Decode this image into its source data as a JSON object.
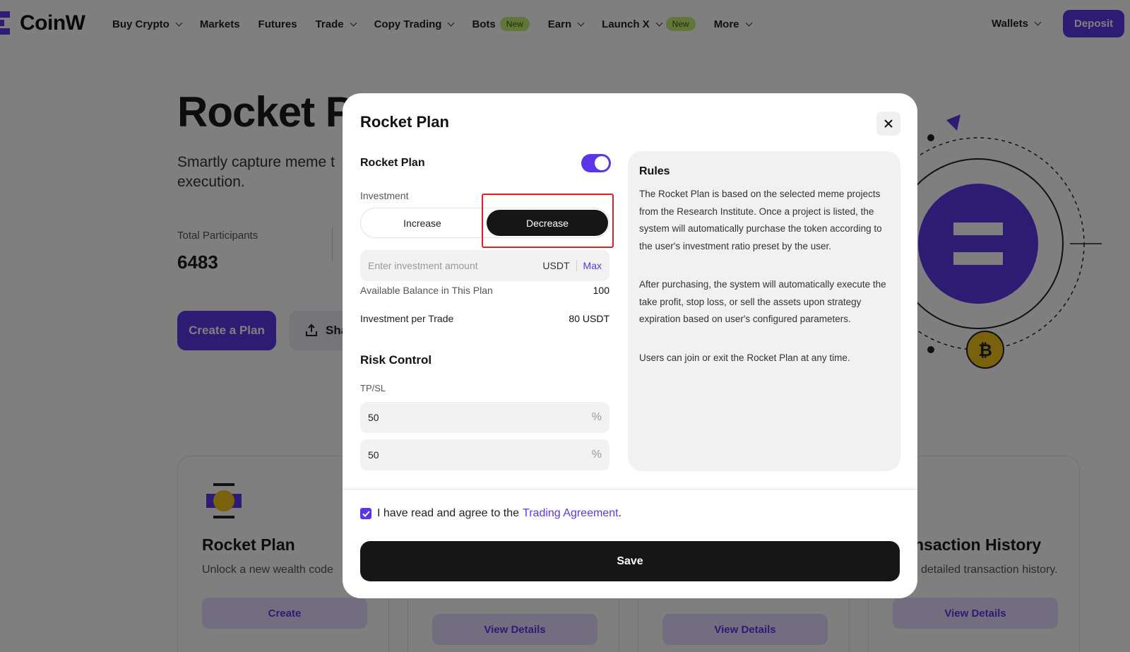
{
  "nav": {
    "logo_text": "CoinW",
    "items": [
      {
        "label": "Buy Crypto",
        "dropdown": true,
        "badge": ""
      },
      {
        "label": "Markets",
        "dropdown": false,
        "badge": ""
      },
      {
        "label": "Futures",
        "dropdown": false,
        "badge": ""
      },
      {
        "label": "Trade",
        "dropdown": true,
        "badge": ""
      },
      {
        "label": "Copy Trading",
        "dropdown": true,
        "badge": ""
      },
      {
        "label": "Bots",
        "dropdown": false,
        "badge": "New"
      },
      {
        "label": "Earn",
        "dropdown": true,
        "badge": ""
      },
      {
        "label": "Launch X",
        "dropdown": true,
        "badge": "New"
      },
      {
        "label": "More",
        "dropdown": true,
        "badge": ""
      }
    ],
    "wallets_label": "Wallets",
    "deposit_label": "Deposit"
  },
  "hero": {
    "title": "Rocket Pl",
    "subtitle": "Smartly capture meme t execution.",
    "stat_label": "Total Participants",
    "stat_value": "6483",
    "create_button": "Create a Plan",
    "share_button": "Sha"
  },
  "cards": [
    {
      "title": "Rocket Plan",
      "subtitle": "Unlock a new wealth code",
      "button": "Create"
    },
    {
      "title": "",
      "subtitle": "",
      "button": "View Details"
    },
    {
      "title": "",
      "subtitle": "",
      "button": "View Details"
    },
    {
      "title": "nsaction History",
      "subtitle": "detailed transaction history.",
      "button": "View Details"
    }
  ],
  "modal": {
    "title": "Rocket Plan",
    "toggle_label": "Rocket Plan",
    "toggle_on": true,
    "investment_label": "Investment",
    "segment": {
      "increase": "Increase",
      "decrease": "Decrease",
      "selected": "Decrease"
    },
    "amount_placeholder": "Enter investment amount",
    "amount_value": "",
    "unit": "USDT",
    "max_label": "Max",
    "balance_label": "Available Balance in This Plan",
    "balance_value": "100",
    "per_trade_label": "Investment per Trade",
    "per_trade_value": "80 USDT",
    "risk_title": "Risk Control",
    "tpsl_label": "TP/SL",
    "tp_value": "50",
    "sl_value": "50",
    "percent_sign": "%",
    "rules": {
      "title": "Rules",
      "paragraphs": [
        "The Rocket Plan is based on the selected meme projects from the Research Institute. Once a project is listed, the system will automatically purchase the token according to the user's investment ratio preset by the user.",
        "After purchasing, the system will automatically execute the take profit, stop loss, or sell the assets upon strategy expiration based on user's configured parameters.",
        "Users can join or exit the Rocket Plan at any time."
      ]
    },
    "agree_text": "I have read and agree to the",
    "agree_link": "Trading Agreement",
    "agree_suffix": ".",
    "agree_checked": true,
    "save_label": "Save"
  },
  "colors": {
    "accent": "#5b36e8",
    "dark": "#161616",
    "badge": "#c7ec74",
    "highlight": "#e02020"
  }
}
